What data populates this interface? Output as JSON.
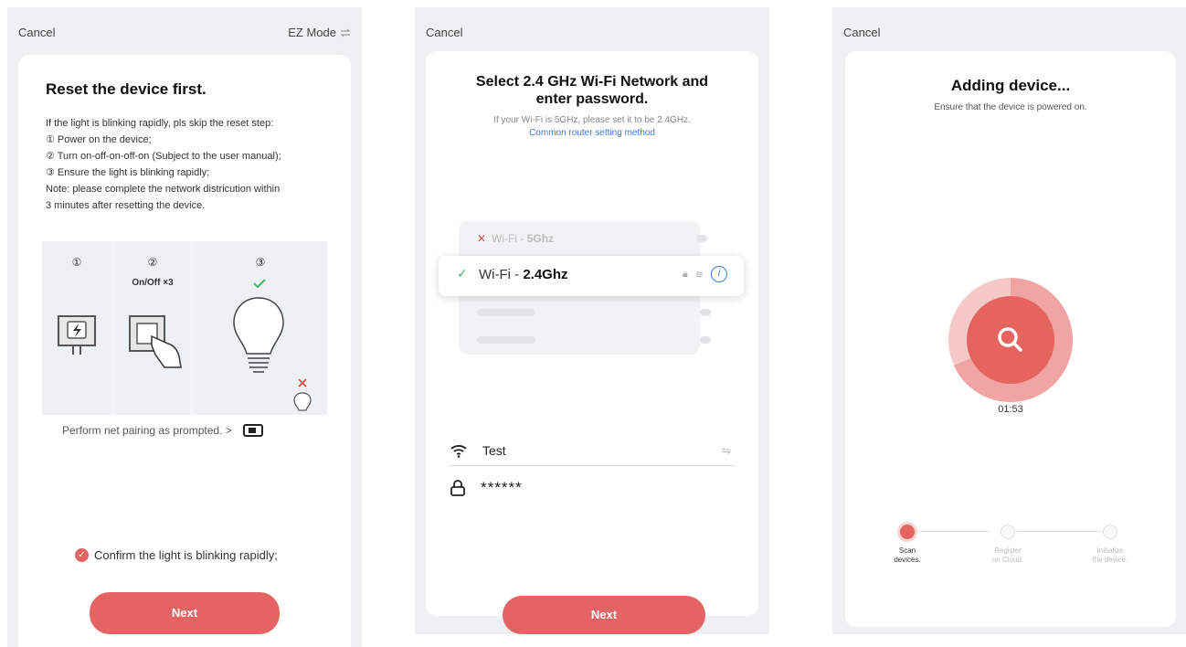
{
  "screen1": {
    "cancel": "Cancel",
    "mode": "EZ Mode",
    "title": "Reset the device first.",
    "instructions": [
      "If the light is blinking rapidly, pls skip the reset step:",
      "① Power on the device;",
      "② Turn on-off-on-off-on (Subject to the user manual);",
      "③ Ensure the light is blinking rapidly;",
      "Note: please complete the network districution within",
      "3 minutes after resetting the device."
    ],
    "panels": {
      "p1_num": "①",
      "p2_num": "②",
      "p2_note": "On/Off ×3",
      "p3_num": "③"
    },
    "perform": "Perform net pairing as prompted. >",
    "confirm": "Confirm the light is blinking rapidly;",
    "next": "Next",
    "accent": "#e46464"
  },
  "screen2": {
    "cancel": "Cancel",
    "title_line1": "Select 2.4 GHz Wi-Fi Network and",
    "title_line2": "enter password.",
    "subtitle": "If your Wi-Fi is 5GHz, please set it to be 2.4GHz.",
    "link": "Common router setting method",
    "wifi_bad_prefix": "Wi-Fi - ",
    "wifi_bad_band": "5Ghz",
    "wifi_good_prefix": "Wi-Fi - ",
    "wifi_good_band": "2.4Ghz",
    "ssid": "Test",
    "password": "******",
    "next": "Next"
  },
  "screen3": {
    "cancel": "Cancel",
    "title": "Adding device...",
    "subtitle": "Ensure that the device is powered on.",
    "timer": "01:53",
    "steps": [
      {
        "line1": "Scan",
        "line2": "devices."
      },
      {
        "line1": "Register",
        "line2": "on Cloud."
      },
      {
        "line1": "Initialize",
        "line2": "the device."
      }
    ]
  }
}
